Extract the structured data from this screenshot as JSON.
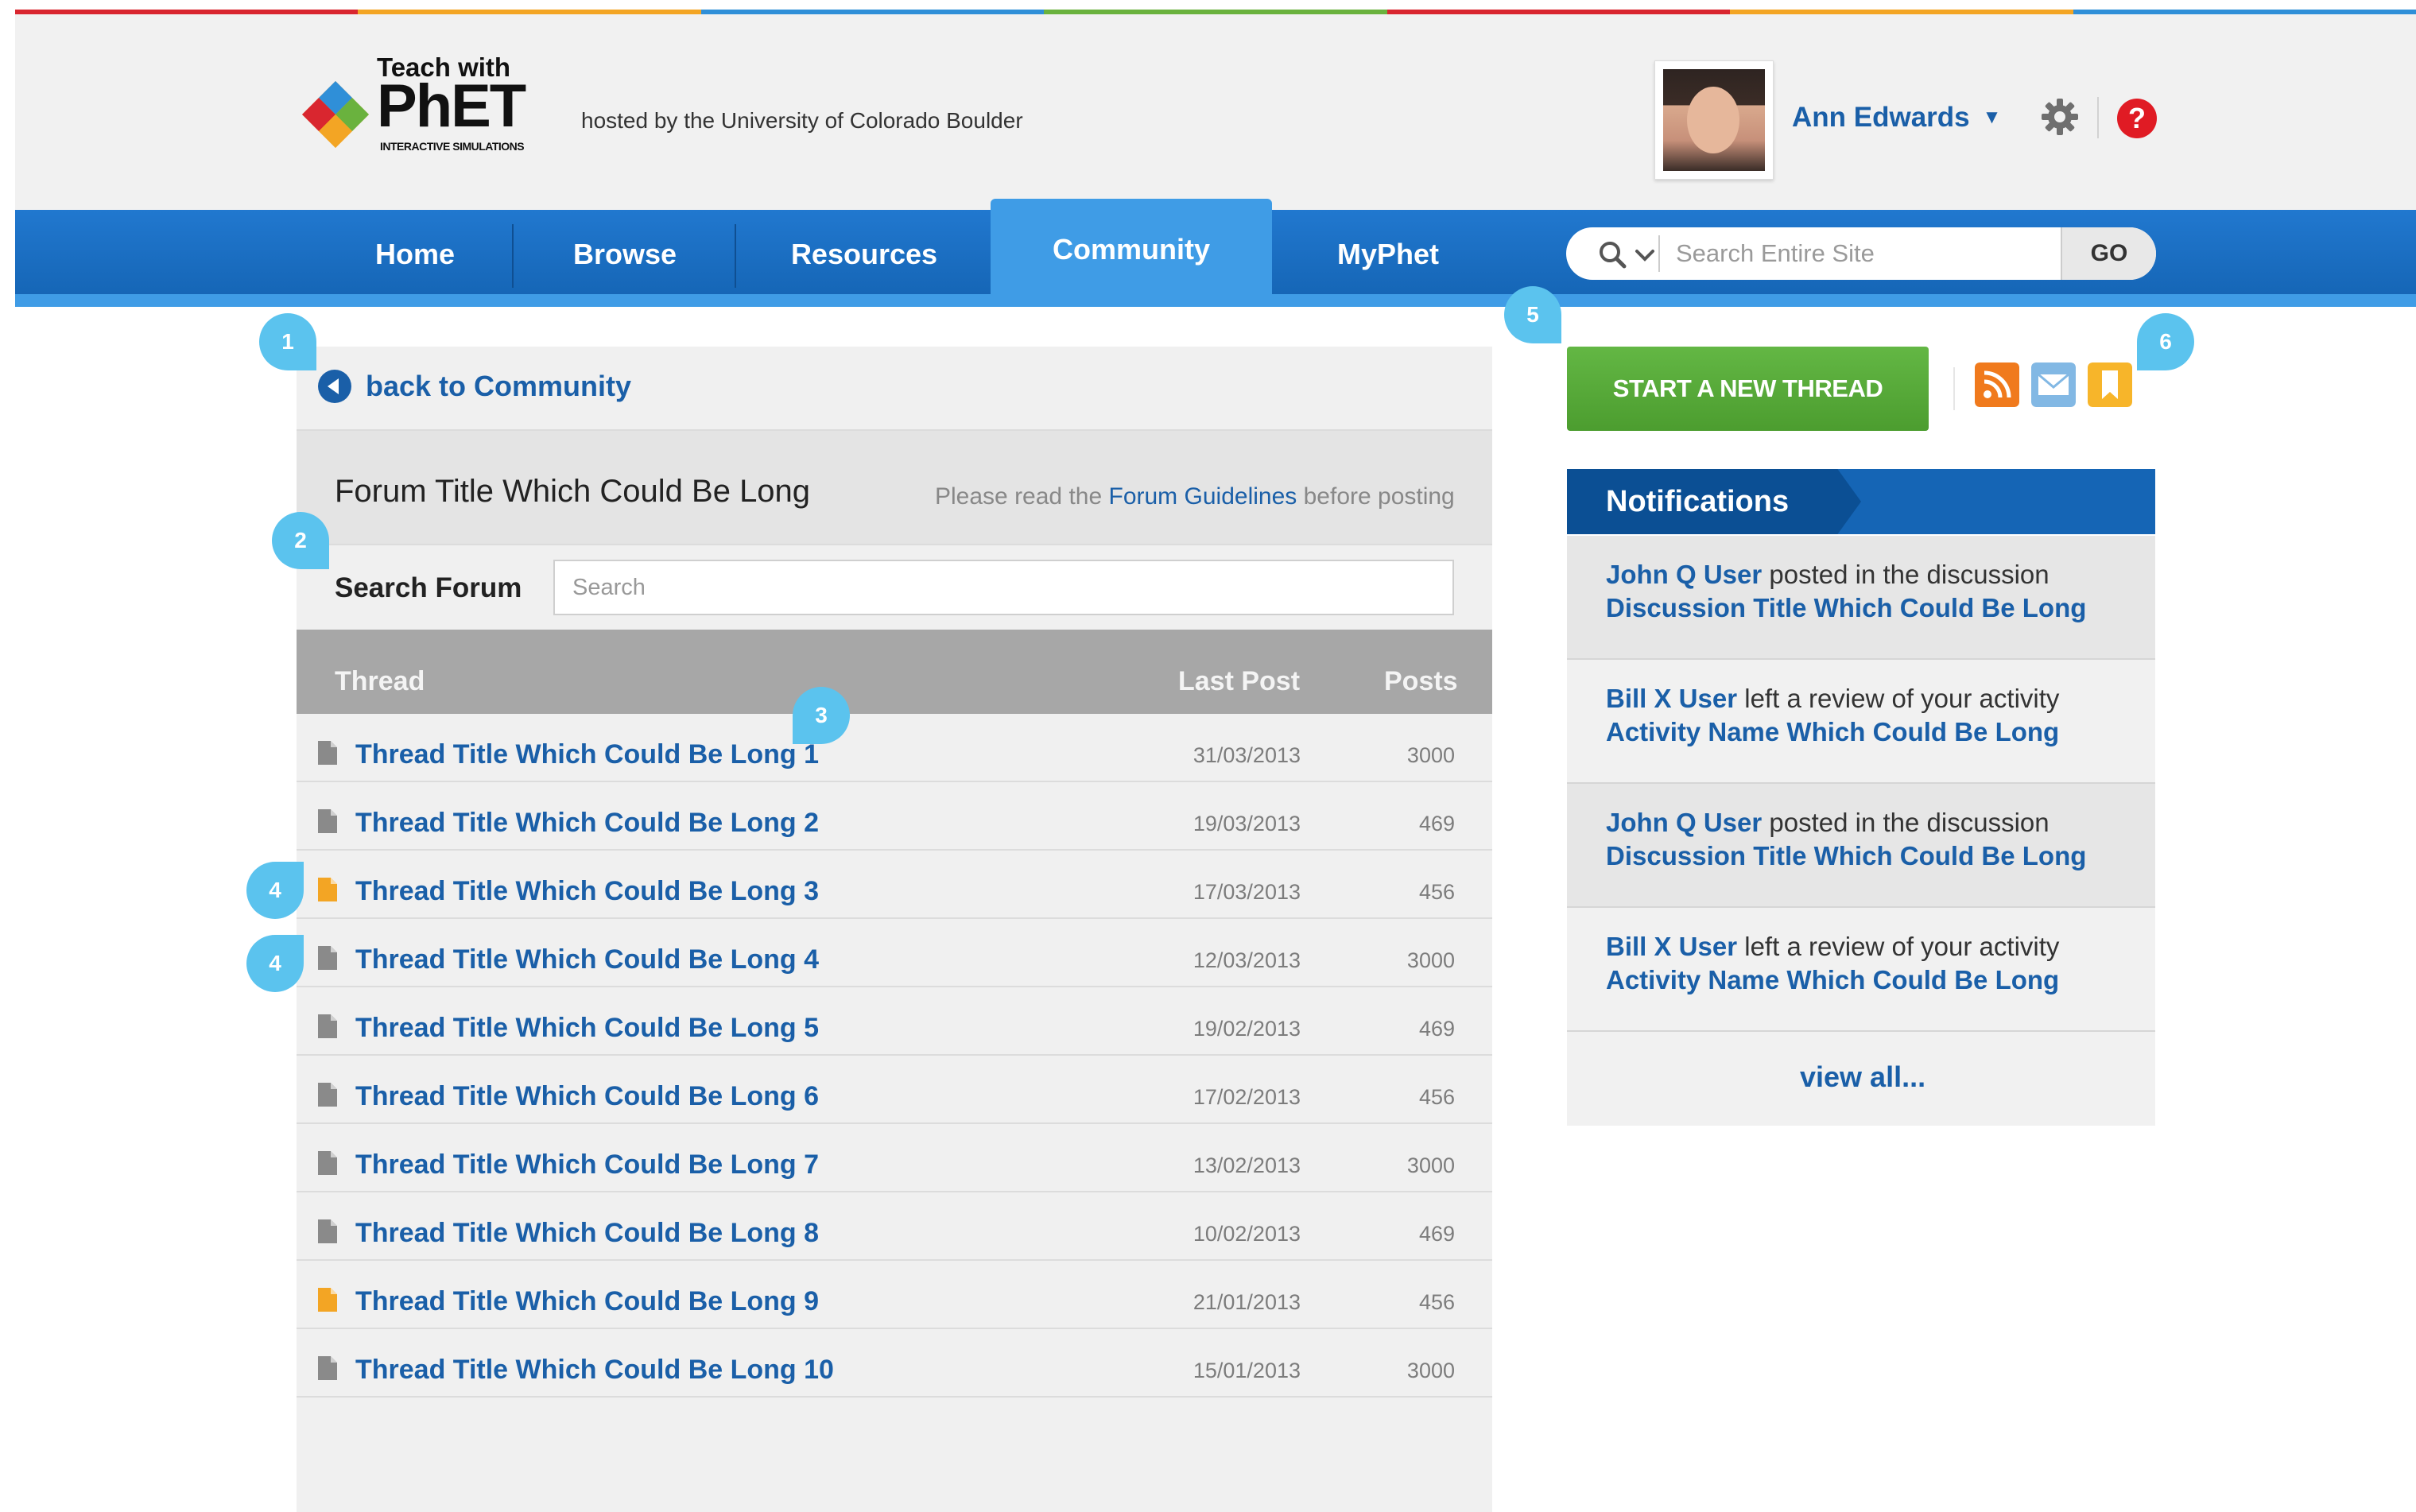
{
  "colors": {
    "top_stripes": [
      "#d9262f",
      "#f3a524",
      "#2f8fd8",
      "#6ab23e",
      "#d9262f",
      "#f3a524",
      "#2f8fd8"
    ],
    "nav_blue": "#1565b5",
    "link_blue": "#1a5fa8",
    "accent_green": "#5cb03f",
    "callout_cyan": "#5bc3ee"
  },
  "header": {
    "logo_teach": "Teach with",
    "logo_name": "PhET",
    "logo_sub": "INTERACTIVE SIMULATIONS",
    "hosted": "hosted by the University of Colorado Boulder",
    "user_name": "Ann Edwards",
    "user_caret": "▼",
    "help_glyph": "?"
  },
  "nav": {
    "items": [
      {
        "label": "Home",
        "active": false
      },
      {
        "label": "Browse",
        "active": false
      },
      {
        "label": "Resources",
        "active": false
      },
      {
        "label": "Community",
        "active": true
      },
      {
        "label": "MyPhet",
        "active": false
      }
    ],
    "search_placeholder": "Search Entire Site",
    "go_label": "GO"
  },
  "forum": {
    "back_label": "back to Community",
    "title": "Forum Title Which Could Be Long",
    "guide_prefix": "Please read the",
    "guide_link": "Forum Guidelines",
    "guide_suffix": "before posting",
    "search_label": "Search Forum",
    "search_placeholder": "Search",
    "columns": {
      "thread": "Thread",
      "last_post": "Last Post",
      "posts": "Posts"
    },
    "threads": [
      {
        "title": "Thread Title Which Could Be Long 1",
        "date": "31/03/2013",
        "posts": "3000",
        "icon": "document-icon",
        "color": "#8a8a8a"
      },
      {
        "title": "Thread Title Which Could Be Long 2",
        "date": "19/03/2013",
        "posts": "469",
        "icon": "document-icon",
        "color": "#8a8a8a"
      },
      {
        "title": "Thread Title Which Could Be Long 3",
        "date": "17/03/2013",
        "posts": "456",
        "icon": "document-icon",
        "color": "#f3a524"
      },
      {
        "title": "Thread Title Which Could Be Long 4",
        "date": "12/03/2013",
        "posts": "3000",
        "icon": "document-icon",
        "color": "#8a8a8a"
      },
      {
        "title": "Thread Title Which Could Be Long 5",
        "date": "19/02/2013",
        "posts": "469",
        "icon": "document-icon",
        "color": "#8a8a8a"
      },
      {
        "title": "Thread Title Which Could Be Long 6",
        "date": "17/02/2013",
        "posts": "456",
        "icon": "document-icon",
        "color": "#8a8a8a"
      },
      {
        "title": "Thread Title Which Could Be Long 7",
        "date": "13/02/2013",
        "posts": "3000",
        "icon": "document-icon",
        "color": "#8a8a8a"
      },
      {
        "title": "Thread Title Which Could Be Long 8",
        "date": "10/02/2013",
        "posts": "469",
        "icon": "document-icon",
        "color": "#8a8a8a"
      },
      {
        "title": "Thread Title Which Could Be Long 9",
        "date": "21/01/2013",
        "posts": "456",
        "icon": "document-icon",
        "color": "#f3a524"
      },
      {
        "title": "Thread Title Which Could Be Long 10",
        "date": "15/01/2013",
        "posts": "3000",
        "icon": "document-icon",
        "color": "#8a8a8a"
      }
    ]
  },
  "sidebar": {
    "start_thread": "START A NEW THREAD",
    "icons": [
      {
        "name": "rss-icon",
        "color": "#f07a1d"
      },
      {
        "name": "email-icon",
        "color": "#82b8e4"
      },
      {
        "name": "bookmark-icon",
        "color": "#f7b52a"
      }
    ],
    "notifications_title": "Notifications",
    "notifications": [
      {
        "user": "John Q User",
        "action": "posted in the discussion",
        "item": "Discussion Title Which Could Be Long"
      },
      {
        "user": "Bill X User",
        "action": "left a review of your activity",
        "item": "Activity Name Which Could Be Long"
      },
      {
        "user": "John Q User",
        "action": "posted in the discussion",
        "item": "Discussion Title Which Could Be Long"
      },
      {
        "user": "Bill X User",
        "action": "left a review of your activity",
        "item": "Activity Name Which Could Be Long"
      }
    ],
    "view_all": "view all..."
  },
  "callouts": [
    "1",
    "2",
    "3",
    "4",
    "4",
    "5",
    "6"
  ]
}
